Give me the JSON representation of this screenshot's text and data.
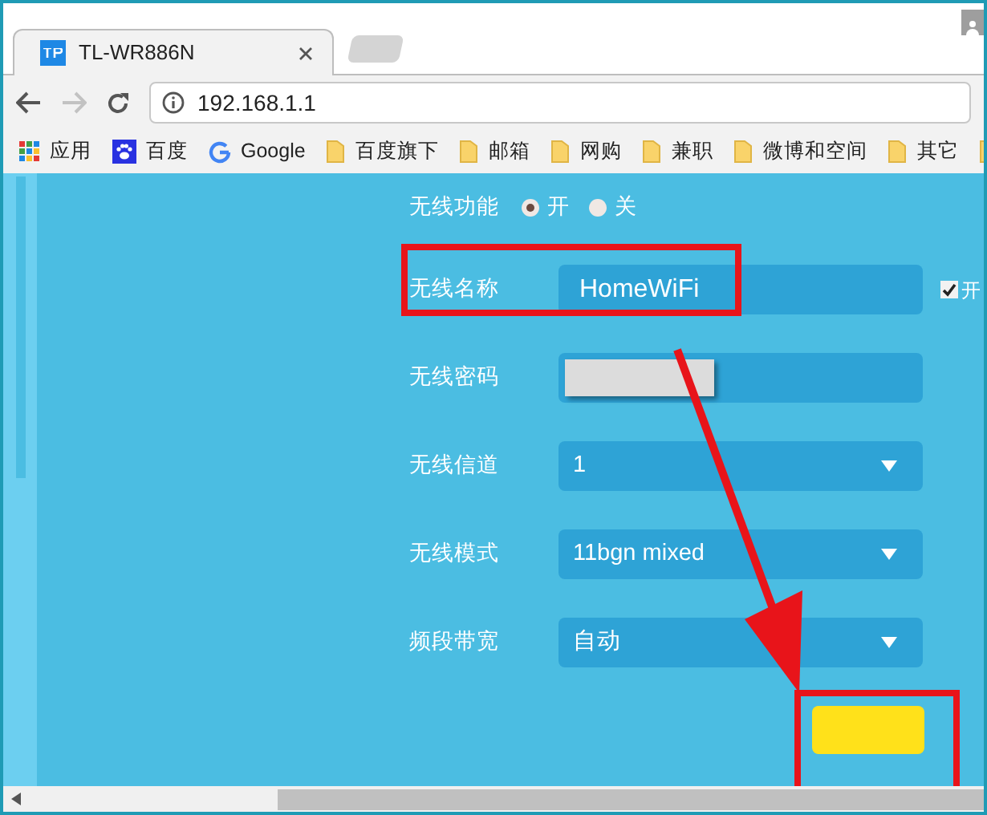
{
  "browser": {
    "tab": {
      "title": "TL-WR886N",
      "selected": true
    },
    "address": "192.168.1.1",
    "bookmarks": [
      {
        "label": "应用",
        "kind": "apps"
      },
      {
        "label": "百度",
        "kind": "paw"
      },
      {
        "label": "Google",
        "kind": "google"
      },
      {
        "label": "百度旗下",
        "kind": "folder"
      },
      {
        "label": "邮箱",
        "kind": "folder"
      },
      {
        "label": "网购",
        "kind": "folder"
      },
      {
        "label": "兼职",
        "kind": "folder"
      },
      {
        "label": "微博和空间",
        "kind": "folder"
      },
      {
        "label": "其它",
        "kind": "folder"
      }
    ]
  },
  "form": {
    "switch": {
      "label": "无线功能",
      "options": [
        {
          "label": "开",
          "selected": true
        },
        {
          "label": "关",
          "selected": false
        }
      ]
    },
    "fields": [
      {
        "label": "无线名称",
        "kind": "text",
        "value": "HomeWiFi",
        "checkbox": {
          "label": "开",
          "checked": true
        }
      },
      {
        "label": "无线密码",
        "kind": "password"
      },
      {
        "label": "无线信道",
        "kind": "select",
        "value": "1"
      },
      {
        "label": "无线模式",
        "kind": "select",
        "value": "11bgn mixed"
      },
      {
        "label": "频段带宽",
        "kind": "select",
        "value": "自动"
      }
    ]
  }
}
